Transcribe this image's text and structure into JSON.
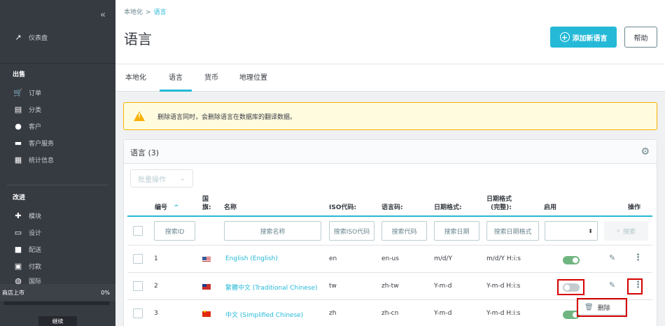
{
  "sidebar": {
    "collapse_glyph": "«",
    "dashboard": "仪表盘",
    "sections": {
      "sell": "出售",
      "improve": "改进"
    },
    "sell_items": [
      "订单",
      "分类",
      "客户",
      "客户服务",
      "统计信息"
    ],
    "improve_items": [
      "模块",
      "设计",
      "配送",
      "付款",
      "国际"
    ],
    "shop_launch_label": "商店上市",
    "shop_launch_percent": "0%",
    "progress": 0,
    "continue_label": "继续"
  },
  "header": {
    "breadcrumb": [
      "本地化",
      "语言"
    ],
    "title": "语言",
    "add_button": "添加新语言",
    "help_button": "帮助"
  },
  "tabs": [
    "本地化",
    "语言",
    "货币",
    "地理位置"
  ],
  "active_tab": "语言",
  "alert": {
    "text": "删除语言同时，会删除语言在数据库的翻译数据。"
  },
  "card": {
    "title": "语言 (3)",
    "bulk_actions": "批量操作"
  },
  "table": {
    "headers": {
      "id": "编号",
      "flag_line1": "国",
      "flag_line2": "旗:",
      "name": "名称",
      "iso": "ISO代码:",
      "lang_code": "语言码:",
      "date_format": "日期格式:",
      "full_date_line1": "日期格式",
      "full_date_line2": "(完整):",
      "enabled": "启用",
      "actions": "操作"
    },
    "sort_indicator": "^",
    "filters": {
      "id": "搜索ID",
      "name": "搜索名称",
      "iso": "搜索ISO代码",
      "lang_code": "搜索代码",
      "date_format": "搜索日期",
      "full_date": "搜索日期格式",
      "search_button": "搜索"
    },
    "rows": [
      {
        "id": "1",
        "flag": "us",
        "name": "English (English)",
        "iso": "en",
        "lang_code": "en-us",
        "date_format": "m/d/Y",
        "full_date": "m/d/Y H:i:s",
        "enabled": true
      },
      {
        "id": "2",
        "flag": "tw",
        "name": "繁體中文 (Traditional Chinese)",
        "iso": "tw",
        "lang_code": "zh-tw",
        "date_format": "Y-m-d",
        "full_date": "Y-m-d H:i:s",
        "enabled": false
      },
      {
        "id": "3",
        "flag": "cn",
        "name": "中文 (Simplified Chinese)",
        "iso": "zh",
        "lang_code": "zh-cn",
        "date_format": "Y-m-d",
        "full_date": "Y-m-d H:i:s",
        "enabled": true
      }
    ]
  },
  "dropdown": {
    "delete_label": "删除"
  },
  "colors": {
    "accent": "#25b9d7",
    "sidebar_bg": "#363a41",
    "toggle_on": "#70b580",
    "highlight_box": "#d60000",
    "alert_border": "#fab000"
  }
}
